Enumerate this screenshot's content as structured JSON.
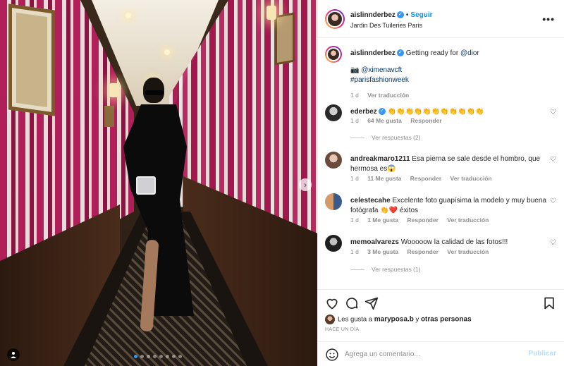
{
  "header": {
    "username": "aislinnderbez",
    "separator": "•",
    "follow_label": "Seguir",
    "location": "Jardin Des Tuileries Paris",
    "more_icon": "more-horizontal-icon"
  },
  "caption": {
    "username": "aislinnderbez",
    "text": "Getting ready for",
    "mention": "@dior",
    "camera_emoji": "📷",
    "photographer": "@ximenavcft",
    "hashtag": "#parisfashionweek",
    "time": "1 d",
    "translate": "Ver traducción"
  },
  "comments": [
    {
      "username": "ederbez",
      "verified": true,
      "text": "👏👏👏👏👏👏👏👏👏👏👏",
      "time": "1 d",
      "likes": "64 Me gusta",
      "reply": "Responder",
      "translate": "",
      "replies": "Ver respuestas (2)"
    },
    {
      "username": "andreakmaro1211",
      "verified": false,
      "text": "Esa pierna se sale desde el hombro, que hermosa es😱",
      "time": "1 d",
      "likes": "11 Me gusta",
      "reply": "Responder",
      "translate": "Ver traducción",
      "replies": ""
    },
    {
      "username": "celestecahe",
      "verified": false,
      "text": "Excelente foto guapísima la modelo y muy buena fotógrafa 👏❤️ éxitos",
      "time": "1 d",
      "likes": "1 Me gusta",
      "reply": "Responder",
      "translate": "Ver traducción",
      "replies": ""
    },
    {
      "username": "memoalvarezs",
      "verified": false,
      "text": "Wooooow la calidad de las fotos!!!",
      "time": "1 d",
      "likes": "3 Me gusta",
      "reply": "Responder",
      "translate": "Ver traducción",
      "replies": "Ver respuestas (1)"
    }
  ],
  "actions": {
    "like_icon": "heart-icon",
    "comment_icon": "comment-icon",
    "share_icon": "share-icon",
    "save_icon": "bookmark-icon"
  },
  "likes_line": {
    "prefix": "Les gusta a",
    "user": "maryposa.b",
    "middle": "y",
    "others": "otras personas"
  },
  "time_ago": "HACE UN DÍA",
  "add_comment": {
    "placeholder": "Agrega un comentario...",
    "publish": "Publicar"
  },
  "carousel": {
    "total_slides": 8,
    "active_slide": 1
  },
  "colors": {
    "accent": "#0095f6",
    "verified": "#3897f0",
    "muted": "#8e8e8e"
  }
}
